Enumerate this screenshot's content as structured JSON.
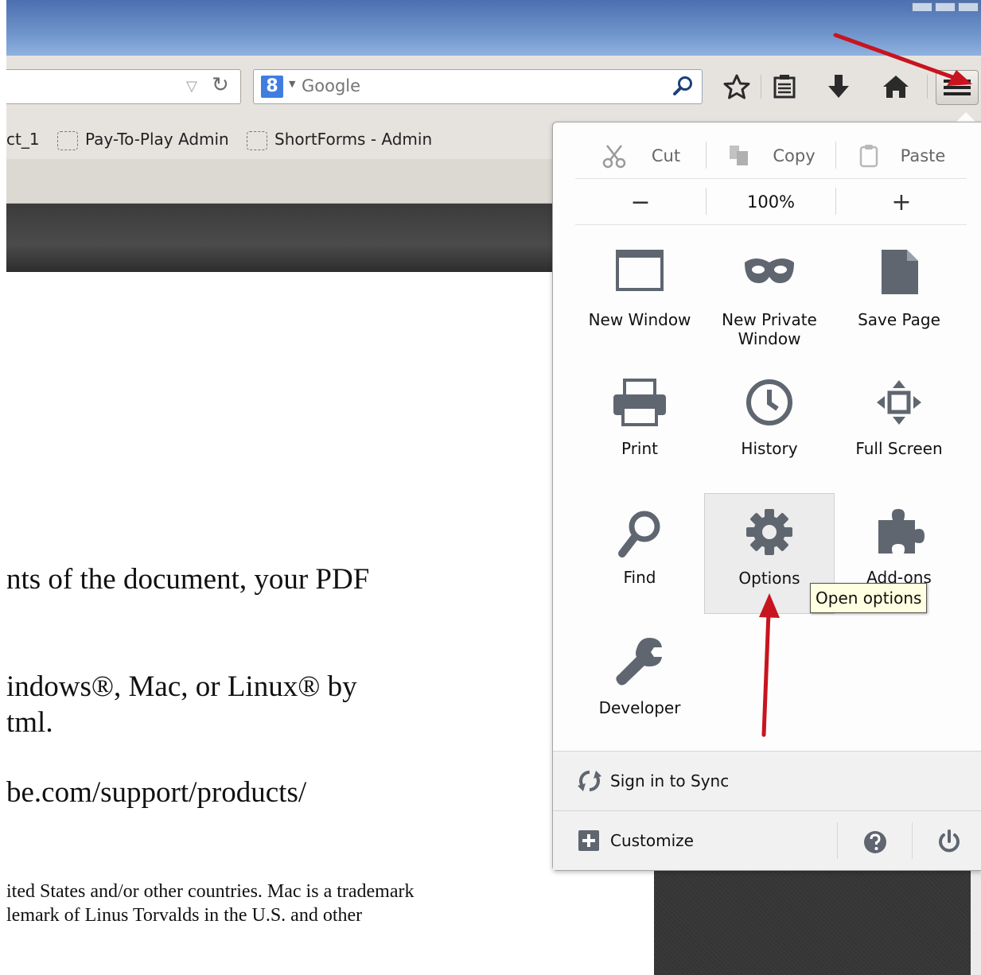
{
  "toolbar": {
    "search_placeholder": "Google",
    "search_engine_letter": "8"
  },
  "bookmarks": [
    {
      "label": "ct_1"
    },
    {
      "label": "Pay-To-Play Admin"
    },
    {
      "label": "ShortForms - Admin"
    }
  ],
  "page_text": {
    "line1": "nts of the document, your PDF",
    "line2": "indows®, Mac, or Linux® by",
    "line3": "tml.",
    "line4": "be.com/support/products/",
    "line5": "ited States and/or other countries. Mac is a trademark",
    "line6": "lemark of Linus Torvalds in the U.S. and other"
  },
  "menu": {
    "edit": {
      "cut": "Cut",
      "copy": "Copy",
      "paste": "Paste"
    },
    "zoom": {
      "minus": "−",
      "level": "100%",
      "plus": "+"
    },
    "items": {
      "new_window": "New Window",
      "new_private_window_line1": "New Private",
      "new_private_window_line2": "Window",
      "save_page": "Save Page",
      "print": "Print",
      "history": "History",
      "full_screen": "Full Screen",
      "find": "Find",
      "options": "Options",
      "addons": "Add-ons",
      "developer": "Developer"
    },
    "tooltip": "Open options",
    "sync": "Sign in to Sync",
    "customize": "Customize"
  },
  "colors": {
    "annotation_arrow": "#c8141e",
    "icon_gray": "#5f6670"
  }
}
